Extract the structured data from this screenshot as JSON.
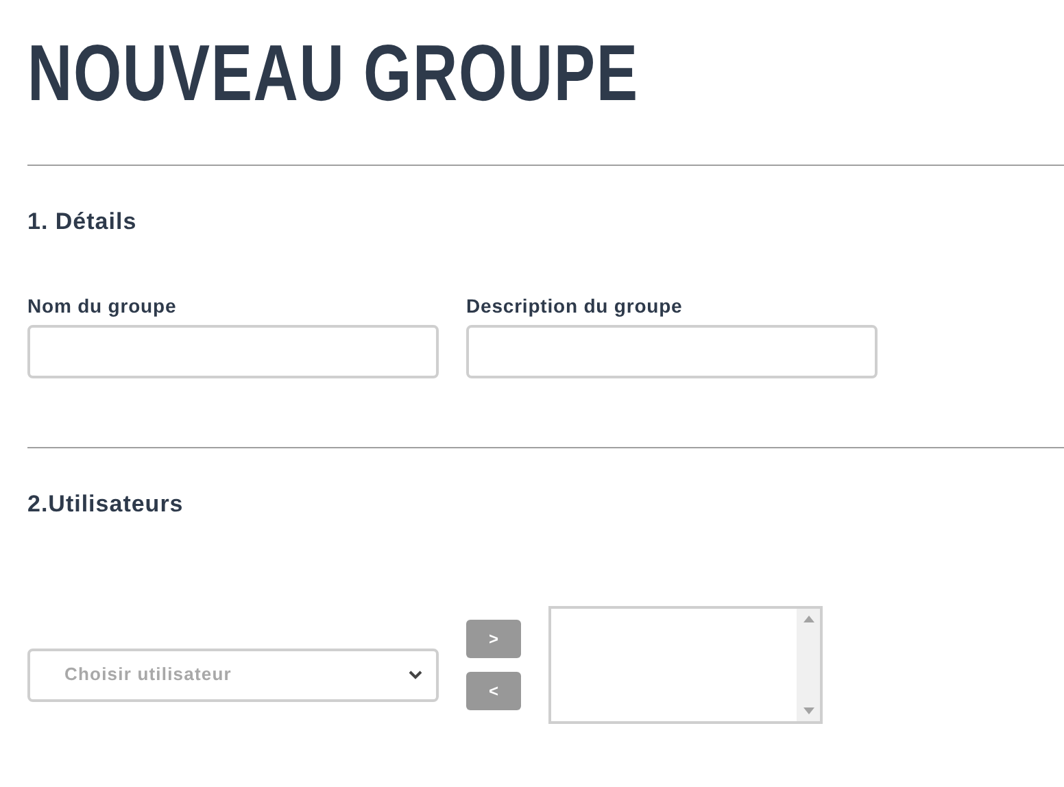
{
  "title": "NOUVEAU GROUPE",
  "sections": [
    {
      "heading": "1. Détails",
      "fields": [
        {
          "label": "Nom du groupe"
        },
        {
          "label": "Description du groupe"
        }
      ]
    },
    {
      "heading": "2.Utilisateurs",
      "user_select": {
        "placeholder": "Choisir utilisateur"
      },
      "move_buttons": [
        ">",
        "<"
      ]
    }
  ]
}
